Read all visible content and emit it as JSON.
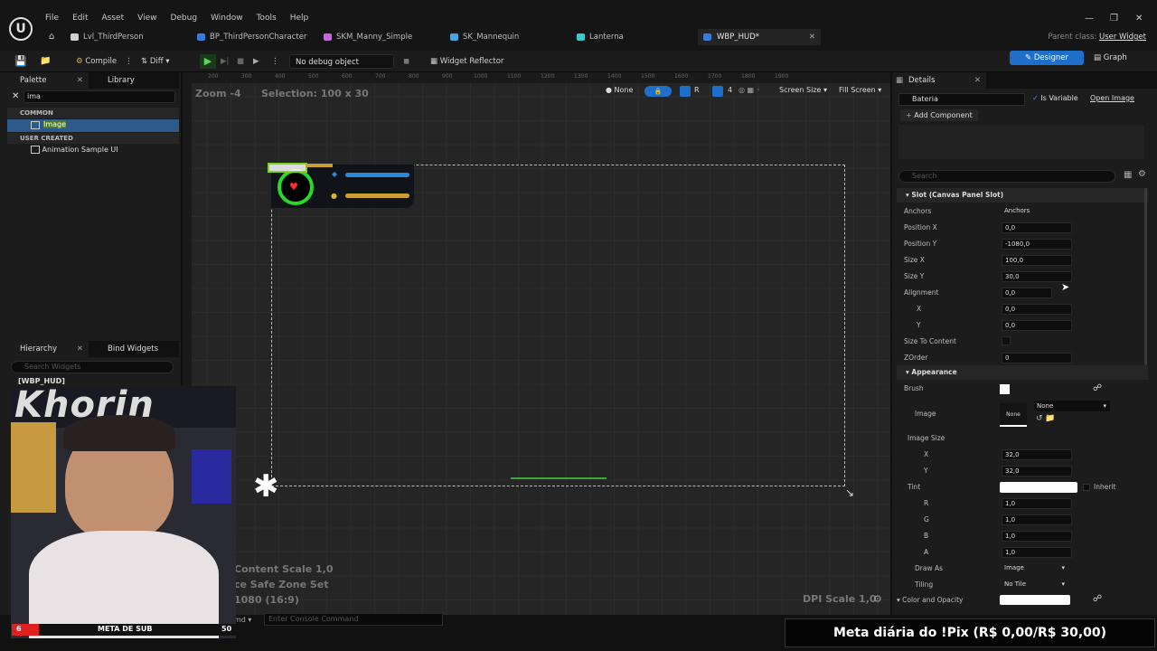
{
  "menu": [
    "File",
    "Edit",
    "Asset",
    "View",
    "Debug",
    "Window",
    "Tools",
    "Help"
  ],
  "tabs": [
    {
      "label": "Lvl_ThirdPerson",
      "color": "#d0d0d0"
    },
    {
      "label": "BP_ThirdPersonCharacter",
      "color": "#3a7bd5"
    },
    {
      "label": "SKM_Manny_Simple",
      "color": "#c06ad6"
    },
    {
      "label": "SK_Mannequin",
      "color": "#4aa3df"
    },
    {
      "label": "Lanterna",
      "color": "#3ec8c8"
    },
    {
      "label": "WBP_HUD*",
      "color": "#3a7bd5"
    }
  ],
  "parent": {
    "label": "Parent class:",
    "value": "User Widget"
  },
  "toolbar": {
    "compile": "Compile",
    "diff": "Diff",
    "debug": "No debug object selected",
    "reflector": "Widget Reflector",
    "designer": "Designer",
    "graph": "Graph"
  },
  "palette": {
    "tab": "Palette",
    "library": "Library",
    "search": "ima",
    "common": "COMMON",
    "item": "Image",
    "user_created": "USER CREATED",
    "user_item": "Animation Sample UI"
  },
  "hierarchy": {
    "tab": "Hierarchy",
    "bind": "Bind Widgets",
    "search": "Search Widgets",
    "root": "[WBP_HUD]"
  },
  "canvas": {
    "zoom": "Zoom -4",
    "selection": "Selection: 100 x 30",
    "none": "None",
    "screen_size": "Screen Size",
    "fill_screen": "Fill Screen",
    "content_scale": "Content Scale 1,0",
    "safe_zone": "ce Safe Zone Set",
    "resolution": "1080 (16:9)",
    "dpi": "DPI Scale 1,0",
    "rulers": [
      "200",
      "300",
      "400",
      "500",
      "600",
      "700",
      "800",
      "900",
      "1000",
      "1100",
      "1200",
      "1300",
      "1400",
      "1500",
      "1600",
      "1700",
      "1800",
      "1900"
    ],
    "r_label": "R",
    "count": "4"
  },
  "details": {
    "tab": "Details",
    "name": "Bateria",
    "is_variable": "Is Variable",
    "open_image": "Open Image",
    "add_component": "Add Component",
    "search": "Search",
    "slot": "Slot (Canvas Panel Slot)",
    "rows": [
      {
        "label": "Anchors",
        "value": "Anchors"
      },
      {
        "label": "Position X",
        "value": "0,0"
      },
      {
        "label": "Position Y",
        "value": "-1080,0"
      },
      {
        "label": "Size X",
        "value": "100,0"
      },
      {
        "label": "Size Y",
        "value": "30,0"
      },
      {
        "label": "Alignment",
        "value": "0,0"
      },
      {
        "label": "X",
        "value": "0,0"
      },
      {
        "label": "Y",
        "value": "0,0"
      },
      {
        "label": "Size To Content",
        "value": ""
      },
      {
        "label": "ZOrder",
        "value": "0"
      }
    ],
    "appearance": "Appearance",
    "brush": "Brush",
    "image": "Image",
    "image_none": "None",
    "image_thumb": "None",
    "image_size": "Image Size",
    "is_x": "32,0",
    "is_y": "32,0",
    "tint": "Tint",
    "inherit": "Inherit",
    "r": "1,0",
    "g": "1,0",
    "b": "1,0",
    "a": "1,0",
    "draw_as": "Draw As",
    "draw_as_val": "Image",
    "tiling": "Tiling",
    "tiling_val": "No Tile",
    "color_opacity": "Color and Opacity"
  },
  "console": {
    "cmd": "md",
    "placeholder": "Enter Console Command"
  },
  "overlay": {
    "meta": "Meta diária do !Pix (R$ 0,00/R$ 30,00)",
    "sub_label": "META DE SUB",
    "sub_left": "6",
    "sub_right": "50",
    "webcam_text": "Khorin"
  }
}
